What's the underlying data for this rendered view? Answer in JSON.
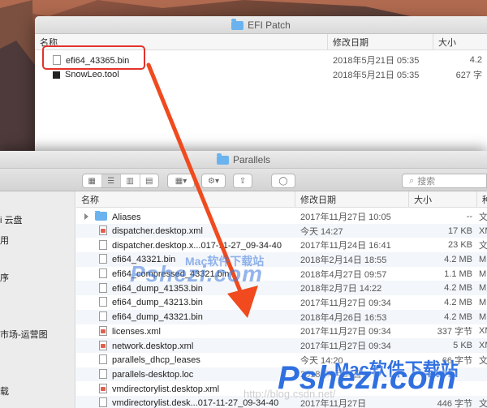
{
  "window1": {
    "title": "EFI Patch",
    "columns": {
      "name": "名称",
      "date": "修改日期",
      "size": "大小"
    },
    "files": [
      {
        "name": "efi64_43365.bin",
        "date": "2018年5月21日 05:35",
        "size": "4.2",
        "icon": "file-icon"
      },
      {
        "name": "SnowLeo.tool",
        "date": "2018年5月21日 05:35",
        "size": "627 字",
        "icon": "executable-icon"
      }
    ]
  },
  "window2": {
    "title": "Parallels",
    "search_placeholder": "搜索",
    "columns": {
      "name": "名称",
      "date": "修改日期",
      "size": "大小",
      "kind": "种"
    },
    "sidebar": [
      {
        "label": "i 云盘"
      },
      {
        "label": "用"
      },
      {
        "label": "序"
      },
      {
        "label": "市场-运营图"
      },
      {
        "label": "载"
      }
    ],
    "files": [
      {
        "name": "Aliases",
        "date": "2017年11月27日 10:05",
        "size": "--",
        "kind": "文",
        "icon": "folder-icon"
      },
      {
        "name": "dispatcher.desktop.xml",
        "date": "今天 14:27",
        "size": "17 KB",
        "kind": "XM",
        "icon": "xml-icon"
      },
      {
        "name": "dispatcher.desktop.x...017-11-27_09-34-40",
        "date": "2017年11月24日 16:41",
        "size": "23 KB",
        "kind": "文",
        "icon": "file-icon"
      },
      {
        "name": "efi64_43321.bin",
        "date": "2018年2月14日 18:55",
        "size": "4.2 MB",
        "kind": "M",
        "icon": "file-icon"
      },
      {
        "name": "efi64_compressed_43321.bin",
        "date": "2018年4月27日 09:57",
        "size": "1.1 MB",
        "kind": "M",
        "icon": "file-icon"
      },
      {
        "name": "efi64_dump_41353.bin",
        "date": "2018年2月7日 14:22",
        "size": "4.2 MB",
        "kind": "M",
        "icon": "file-icon"
      },
      {
        "name": "efi64_dump_43213.bin",
        "date": "2017年11月27日 09:34",
        "size": "4.2 MB",
        "kind": "M",
        "icon": "file-icon"
      },
      {
        "name": "efi64_dump_43321.bin",
        "date": "2018年4月26日 16:53",
        "size": "4.2 MB",
        "kind": "M",
        "icon": "file-icon"
      },
      {
        "name": "licenses.xml",
        "date": "2017年11月27日 09:34",
        "size": "337 字节",
        "kind": "XM",
        "icon": "xml-icon"
      },
      {
        "name": "network.desktop.xml",
        "date": "2017年11月27日 09:34",
        "size": "5 KB",
        "kind": "XM",
        "icon": "xml-icon"
      },
      {
        "name": "parallels_dhcp_leases",
        "date": "今天 14:20",
        "size": "66 字节",
        "kind": "文",
        "icon": "file-icon"
      },
      {
        "name": "parallels-desktop.loc",
        "date": "2018年4月26日",
        "size": "",
        "kind": "",
        "icon": "file-icon"
      },
      {
        "name": "vmdirectorylist.desktop.xml",
        "date": "",
        "size": "",
        "kind": "",
        "icon": "xml-icon"
      },
      {
        "name": "vmdirectorylist.desk...017-11-27_09-34-40",
        "date": "2017年11月27日",
        "size": "446 字节",
        "kind": "文",
        "icon": "file-icon"
      }
    ]
  },
  "watermarks": {
    "center_small": "Mac软件下载站",
    "center_large": "Pshezi.com",
    "corner_small": "Mac软件下载站",
    "corner_large": "Pshezi.com",
    "blog": "http://blog.csdn.net/"
  },
  "colors": {
    "highlight": "#e4322b",
    "arrow": "#f04a1e",
    "selection": "#3a7bd5"
  }
}
